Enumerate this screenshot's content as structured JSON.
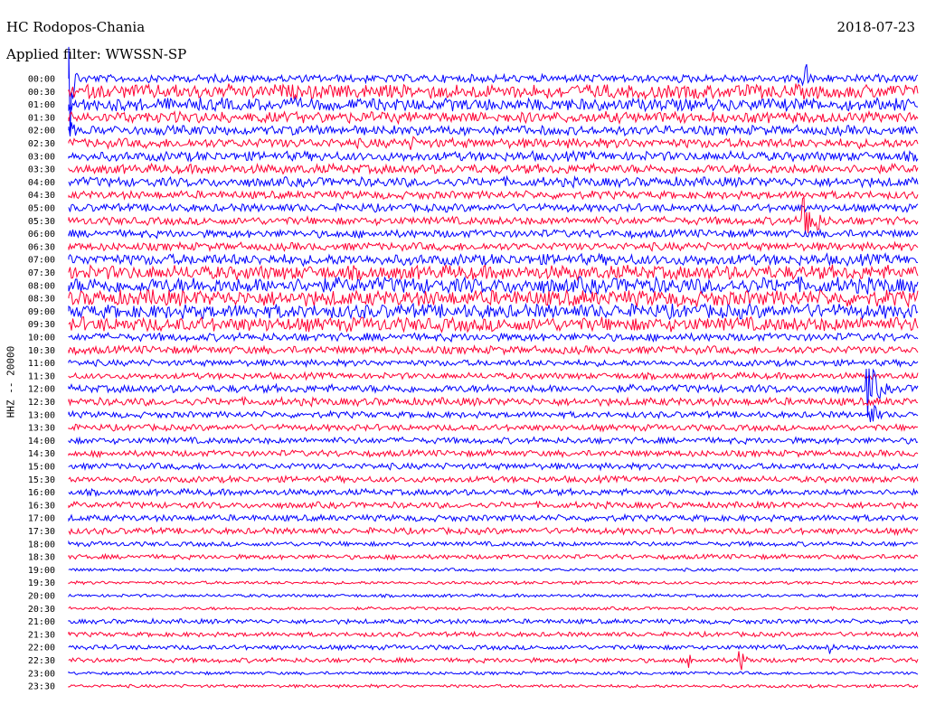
{
  "header": {
    "station": "HC Rodopos-Chania",
    "date": "2018-07-23",
    "filter": "Applied filter: WWSSN-SP"
  },
  "chart_data": {
    "type": "line",
    "ylabel": "HHZ -- 20000",
    "colors": [
      "#0000ff",
      "#ff0033"
    ],
    "row_labels": [
      "00:00",
      "00:30",
      "01:00",
      "01:30",
      "02:00",
      "02:30",
      "03:00",
      "03:30",
      "04:00",
      "04:30",
      "05:00",
      "05:30",
      "06:00",
      "06:30",
      "07:00",
      "07:30",
      "08:00",
      "08:30",
      "09:00",
      "09:30",
      "10:00",
      "10:30",
      "11:00",
      "11:30",
      "12:00",
      "12:30",
      "13:00",
      "13:30",
      "14:00",
      "14:30",
      "15:00",
      "15:30",
      "16:00",
      "16:30",
      "17:00",
      "17:30",
      "18:00",
      "18:30",
      "19:00",
      "19:30",
      "20:00",
      "20:30",
      "21:00",
      "21:30",
      "22:00",
      "22:30",
      "23:00",
      "23:30"
    ],
    "noise_amplitude": [
      5,
      9,
      8,
      7,
      6,
      6,
      6,
      6,
      6,
      5,
      5,
      5,
      5,
      5,
      7,
      9,
      10,
      10,
      9,
      9,
      5,
      5,
      4,
      4,
      5,
      5,
      4,
      4,
      4,
      4,
      4,
      4,
      4,
      4,
      4,
      4,
      3,
      3,
      2,
      2,
      2,
      2,
      3,
      3,
      3,
      3,
      2,
      2
    ],
    "events": [
      {
        "row": 0,
        "x_frac": 0.0,
        "amp": 90,
        "len": 12
      },
      {
        "row": 4,
        "x_frac": 0.0,
        "amp": 14,
        "len": 25
      },
      {
        "row": 5,
        "x_frac": 0.4,
        "amp": 10,
        "len": 60
      },
      {
        "row": 0,
        "x_frac": 0.865,
        "amp": 90,
        "len": 6
      },
      {
        "row": 11,
        "x_frac": 0.865,
        "amp": 35,
        "len": 40
      },
      {
        "row": 17,
        "x_frac": 0.1,
        "amp": 16,
        "len": 15
      },
      {
        "row": 19,
        "x_frac": 0.065,
        "amp": 10,
        "len": 15
      },
      {
        "row": 24,
        "x_frac": 0.94,
        "amp": 35,
        "len": 35
      },
      {
        "row": 26,
        "x_frac": 0.945,
        "amp": 15,
        "len": 25
      },
      {
        "row": 44,
        "x_frac": 0.895,
        "amp": 9,
        "len": 25
      },
      {
        "row": 45,
        "x_frac": 0.73,
        "amp": 9,
        "len": 20
      },
      {
        "row": 45,
        "x_frac": 0.79,
        "amp": 14,
        "len": 25
      }
    ]
  }
}
